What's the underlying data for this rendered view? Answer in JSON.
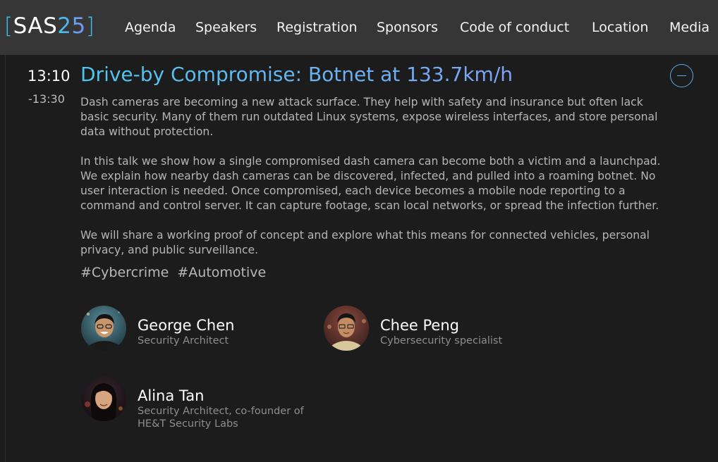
{
  "header": {
    "logo": {
      "bracket_open": "[",
      "name": "SAS",
      "year": "25",
      "bracket_close": "]"
    },
    "nav": [
      {
        "label": "Agenda"
      },
      {
        "label": "Speakers"
      },
      {
        "label": "Registration"
      },
      {
        "label": "Sponsors"
      },
      {
        "label": "Code of conduct"
      },
      {
        "label": "Location"
      },
      {
        "label": "Media"
      }
    ]
  },
  "session": {
    "time_start": "13:10",
    "time_end": "-13:30",
    "title": "Drive-by Compromise: Botnet at 133.7km/h",
    "paragraphs": [
      "Dash cameras are becoming a new attack surface. They help with safety and insurance but often lack basic security. Many of them run outdated Linux systems, expose wireless interfaces, and store personal data without protection.",
      "In this talk we show how a single compromised dash camera can become both a victim and a launchpad. We explain how nearby dash cameras can be discovered, infected, and pulled into a roaming botnet. No user interaction is needed. Once compromised, each device becomes a mobile node reporting to a command and control server. It can capture footage, scan local networks, or spread the infection further.",
      "We will share a working proof of concept and explore what this means for connected vehicles, personal privacy, and public surveillance."
    ],
    "tags": [
      "#Cybercrime",
      "#Automotive"
    ],
    "speakers": [
      {
        "name": "George Chen",
        "role": "Security Architect"
      },
      {
        "name": "Chee Peng",
        "role": "Cybersecurity specialist"
      },
      {
        "name": "Alina Tan",
        "role": "Security Architect, co-founder of HE&T Security Labs"
      }
    ]
  },
  "colors": {
    "background": "#1c1c1c",
    "header_bg": "#363636",
    "accent_cyan": "#4cc7f0",
    "accent_blue": "#7fa4f7",
    "body_text": "#b5b5b5"
  },
  "icons": {
    "collapse": "minus-circle-icon"
  }
}
